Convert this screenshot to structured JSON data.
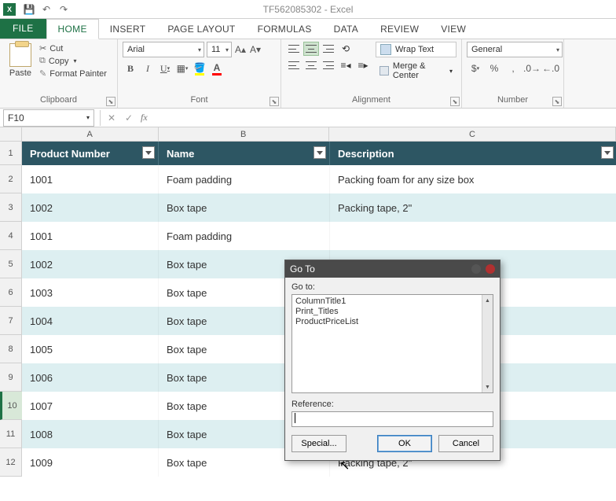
{
  "title": "TF562085302 - Excel",
  "qat": {
    "save": "💾",
    "undo": "↶",
    "redo": "↷"
  },
  "tabs": {
    "file": "FILE",
    "home": "HOME",
    "insert": "INSERT",
    "pagelayout": "PAGE LAYOUT",
    "formulas": "FORMULAS",
    "data": "DATA",
    "review": "REVIEW",
    "view": "VIEW"
  },
  "clipboard": {
    "paste": "Paste",
    "cut": "Cut",
    "copy": "Copy",
    "format": "Format Painter",
    "label": "Clipboard"
  },
  "font": {
    "name": "Arial",
    "size": "11",
    "label": "Font"
  },
  "alignment": {
    "wrap": "Wrap Text",
    "merge": "Merge & Center",
    "label": "Alignment"
  },
  "number": {
    "format": "General",
    "label": "Number"
  },
  "namebox": "F10",
  "columns": {
    "A": "A",
    "B": "B",
    "C": "C"
  },
  "headers": {
    "A": "Product Number",
    "B": "Name",
    "C": "Description"
  },
  "rows": [
    {
      "n": "1"
    },
    {
      "n": "2",
      "A": "1001",
      "B": "Foam padding",
      "C": "Packing foam for any size box"
    },
    {
      "n": "3",
      "A": "1002",
      "B": "Box tape",
      "C": "Packing tape, 2\""
    },
    {
      "n": "4",
      "A": "1001",
      "B": "Foam padding",
      "C": ""
    },
    {
      "n": "5",
      "A": "1002",
      "B": "Box tape",
      "C": ""
    },
    {
      "n": "6",
      "A": "1003",
      "B": "Box tape",
      "C": ""
    },
    {
      "n": "7",
      "A": "1004",
      "B": "Box tape",
      "C": ""
    },
    {
      "n": "8",
      "A": "1005",
      "B": "Box tape",
      "C": ""
    },
    {
      "n": "9",
      "A": "1006",
      "B": "Box tape",
      "C": ""
    },
    {
      "n": "10",
      "A": "1007",
      "B": "Box tape",
      "C": ""
    },
    {
      "n": "11",
      "A": "1008",
      "B": "Box tape",
      "C": ""
    },
    {
      "n": "12",
      "A": "1009",
      "B": "Box tape",
      "C": "Packing tape, 2\""
    }
  ],
  "dialog": {
    "title": "Go To",
    "goto_label": "Go to:",
    "items": [
      "ColumnTitle1",
      "Print_Titles",
      "ProductPriceList"
    ],
    "reference_label": "Reference:",
    "reference_value": "",
    "special": "Special...",
    "ok": "OK",
    "cancel": "Cancel"
  }
}
